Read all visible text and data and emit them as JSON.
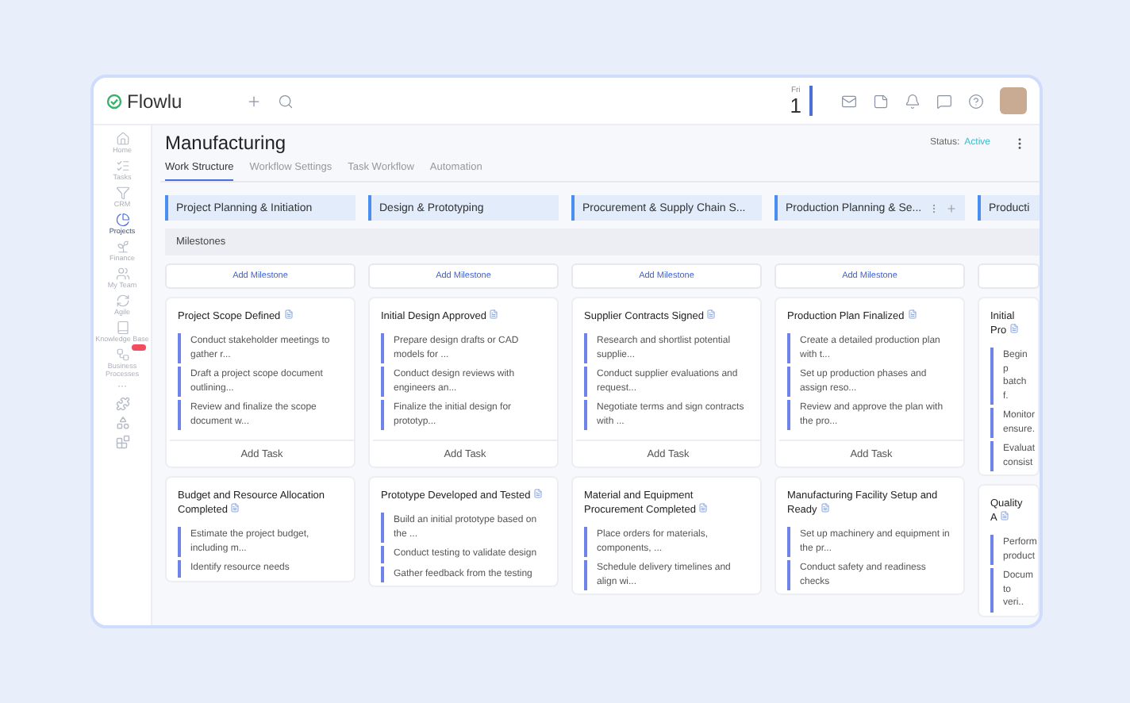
{
  "topbar": {
    "logo": "Flowlu",
    "date": {
      "weekday": "Fri",
      "day": "1"
    }
  },
  "sidebar": {
    "items": [
      {
        "label": "Home",
        "selected": false
      },
      {
        "label": "Tasks",
        "selected": false
      },
      {
        "label": "CRM",
        "selected": false
      },
      {
        "label": "Projects",
        "selected": true
      },
      {
        "label": "Finance",
        "selected": false
      },
      {
        "label": "My Team",
        "selected": false
      },
      {
        "label": "Agile",
        "selected": false
      },
      {
        "label": "Knowledge Base",
        "selected": false
      },
      {
        "label": "Business Processes",
        "selected": false,
        "badge": true
      }
    ],
    "more": "···"
  },
  "header": {
    "title": "Manufacturing",
    "status_label": "Status:",
    "status": "Active"
  },
  "tabs": [
    {
      "label": "Work Structure",
      "selected": true
    },
    {
      "label": "Workflow Settings",
      "selected": false
    },
    {
      "label": "Task Workflow",
      "selected": false
    },
    {
      "label": "Automation",
      "selected": false
    }
  ],
  "milestones_label": "Milestones",
  "columns": [
    {
      "stage": "Project Planning & Initiation",
      "add_milestone": "Add Milestone",
      "milestones": [
        {
          "title": "Project Scope Defined",
          "tasks": [
            "Conduct stakeholder meetings to gather r...",
            "Draft a project scope document outlining...",
            "Review and finalize the scope document w..."
          ],
          "add_task": "Add Task"
        },
        {
          "title": "Budget and Resource Allocation Completed",
          "tasks": [
            "Estimate the project budget, including m...",
            "Identify resource needs"
          ]
        }
      ]
    },
    {
      "stage": "Design & Prototyping",
      "add_milestone": "Add Milestone",
      "milestones": [
        {
          "title": "Initial Design Approved",
          "tasks": [
            "Prepare design drafts or CAD models for ...",
            "Conduct design reviews with engineers an...",
            "Finalize the initial design for prototyp..."
          ],
          "add_task": "Add Task"
        },
        {
          "title": "Prototype Developed and Tested",
          "tasks": [
            "Build an initial prototype based on the ...",
            "Conduct testing to validate design",
            "Gather feedback from the testing"
          ]
        }
      ]
    },
    {
      "stage": "Procurement & Supply Chain S...",
      "add_milestone": "Add Milestone",
      "milestones": [
        {
          "title": "Supplier Contracts Signed",
          "tasks": [
            "Research and shortlist potential supplie...",
            "Conduct supplier evaluations and request...",
            "Negotiate terms and sign contracts with ..."
          ],
          "add_task": "Add Task"
        },
        {
          "title": "Material and Equipment Procurement Completed",
          "tasks": [
            "Place orders for materials, components, ...",
            "Schedule delivery timelines and align wi..."
          ]
        }
      ]
    },
    {
      "stage": "Production Planning & Se...",
      "controls": true,
      "add_milestone": "Add Milestone",
      "milestones": [
        {
          "title": "Production Plan Finalized",
          "tasks": [
            "Create a detailed production plan with t...",
            "Set up production phases and assign reso...",
            "Review and approve the plan with the pro..."
          ],
          "add_task": "Add Task"
        },
        {
          "title": "Manufacturing Facility Setup and Ready",
          "tasks": [
            "Set up machinery and equipment in the pr...",
            "Conduct safety and readiness checks"
          ]
        }
      ]
    },
    {
      "stage": "Producti",
      "milestones": [
        {
          "title": "Initial Pro",
          "tasks": [
            "Begin p batch f.",
            "Monitor ensure.",
            "Evaluat consist"
          ]
        },
        {
          "title": "Quality A",
          "tasks": [
            "Perform product",
            "Docum to veri.."
          ]
        }
      ]
    }
  ]
}
